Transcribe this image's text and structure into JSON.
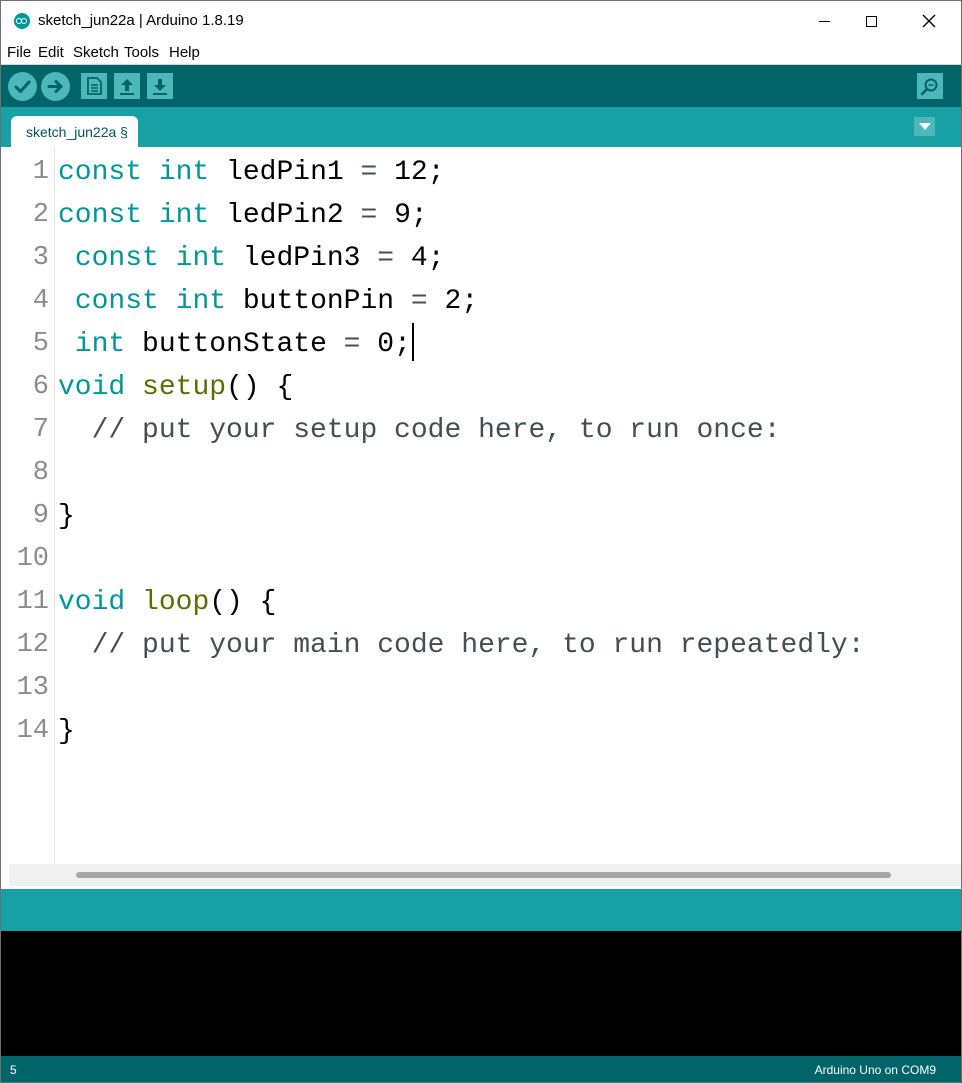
{
  "window": {
    "title": "sketch_jun22a | Arduino 1.8.19",
    "icon": "arduino-logo-icon"
  },
  "menu": [
    "File",
    "Edit",
    "Sketch",
    "Tools",
    "Help"
  ],
  "toolbar": {
    "buttons": [
      {
        "name": "verify",
        "icon": "checkmark-icon"
      },
      {
        "name": "upload",
        "icon": "arrow-right-icon"
      },
      {
        "name": "new",
        "icon": "document-icon"
      },
      {
        "name": "open",
        "icon": "arrow-up-icon"
      },
      {
        "name": "save",
        "icon": "arrow-down-icon"
      },
      {
        "name": "serial-monitor",
        "icon": "magnifier-icon"
      }
    ]
  },
  "tabs": [
    {
      "label": "sketch_jun22a §",
      "active": true
    }
  ],
  "editor": {
    "lines": [
      {
        "num": "1",
        "text": "const int ledPin1 = 12;"
      },
      {
        "num": "2",
        "text": "const int ledPin2 = 9;"
      },
      {
        "num": "3",
        "text": " const int ledPin3 = 4;"
      },
      {
        "num": "4",
        "text": " const int buttonPin = 2;"
      },
      {
        "num": "5",
        "text": " int buttonState = 0;"
      },
      {
        "num": "6",
        "text": "void setup() {"
      },
      {
        "num": "7",
        "text": "  // put your setup code here, to run once:"
      },
      {
        "num": "8",
        "text": ""
      },
      {
        "num": "9",
        "text": "}"
      },
      {
        "num": "10",
        "text": ""
      },
      {
        "num": "11",
        "text": "void loop() {"
      },
      {
        "num": "12",
        "text": "  // put your main code here, to run repeatedly:"
      },
      {
        "num": "13",
        "text": ""
      },
      {
        "num": "14",
        "text": "}"
      }
    ],
    "caret_line": 5
  },
  "status": {
    "line": "5",
    "board": "Arduino Uno on COM9"
  },
  "colors": {
    "toolbar": "#006468",
    "tabbar": "#17a1a5",
    "keyword": "#00979c",
    "function": "#5e6d03",
    "comment": "#434f54",
    "console": "#000000"
  }
}
